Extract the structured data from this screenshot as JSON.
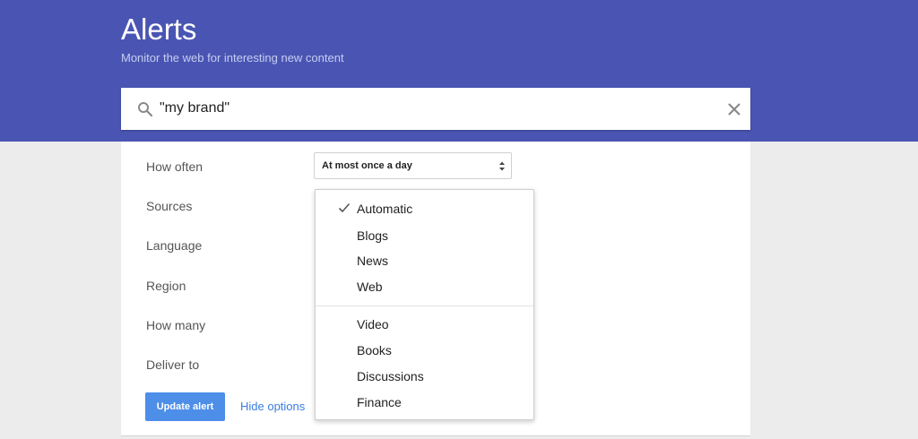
{
  "header": {
    "title": "Alerts",
    "subtitle": "Monitor the web for interesting new content"
  },
  "search": {
    "query": "\"my brand\"",
    "search_icon": "search-icon",
    "clear_icon": "close-icon"
  },
  "options": {
    "labels": [
      "How often",
      "Sources",
      "Language",
      "Region",
      "How many",
      "Deliver to"
    ],
    "how_often_value": "At most once a day"
  },
  "sources_dropdown": {
    "selected": "Automatic",
    "group1": [
      "Automatic",
      "Blogs",
      "News",
      "Web"
    ],
    "group2": [
      "Video",
      "Books",
      "Discussions",
      "Finance"
    ]
  },
  "actions": {
    "update_label": "Update alert",
    "hide_label": "Hide options"
  },
  "colors": {
    "header_bg": "#4a55b3",
    "primary_button": "#4d8ee9",
    "link": "#3b7de0"
  }
}
